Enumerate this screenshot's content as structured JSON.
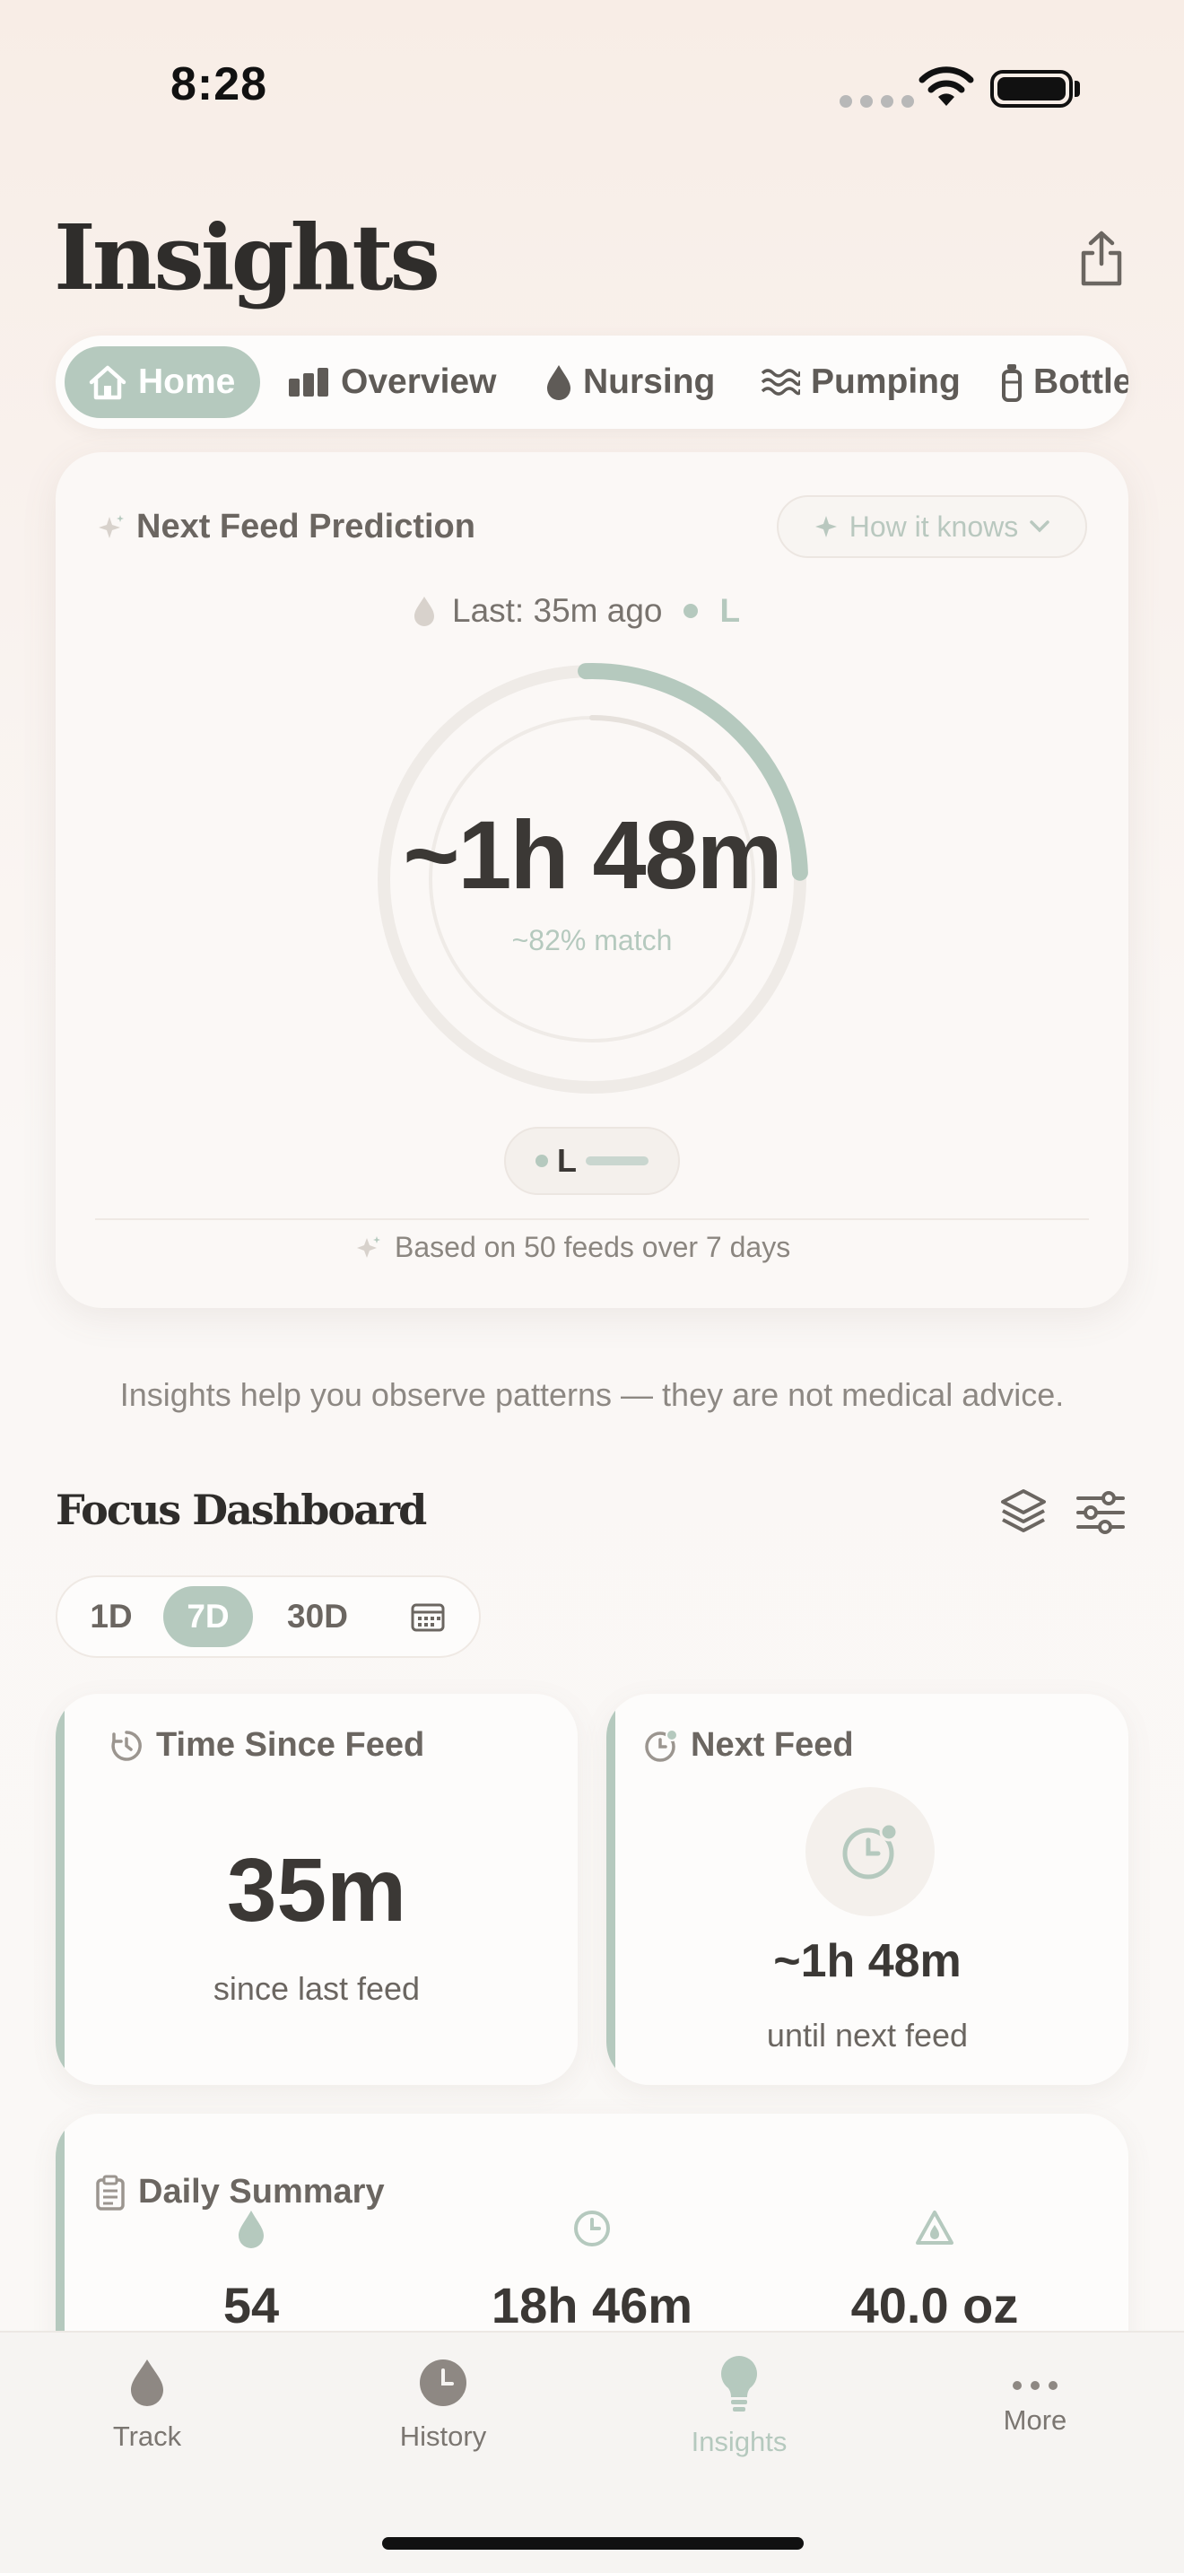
{
  "status": {
    "time": "8:28"
  },
  "header": {
    "title": "Insights"
  },
  "tabs": [
    {
      "label": "Home"
    },
    {
      "label": "Overview"
    },
    {
      "label": "Nursing"
    },
    {
      "label": "Pumping"
    },
    {
      "label": "Bottle"
    }
  ],
  "prediction": {
    "title": "Next Feed Prediction",
    "how_label": "How it knows",
    "last_label": "Last: 35m ago",
    "last_side": "L",
    "value": "~1h 48m",
    "match": "~82% match",
    "match_fraction": 0.82,
    "side_pill": "L",
    "based_on": "Based on 50 feeds over 7 days"
  },
  "disclaimer": "Insights help you observe patterns — they are not medical advice.",
  "focus": {
    "title": "Focus Dashboard",
    "ranges": [
      "1D",
      "7D",
      "30D"
    ],
    "active_range": "7D"
  },
  "time_since": {
    "label": "Time Since Feed",
    "value": "35m",
    "sub": "since last feed"
  },
  "next_feed": {
    "label": "Next Feed",
    "value": "~1h 48m",
    "sub": "until next feed"
  },
  "daily_summary": {
    "label": "Daily Summary",
    "values": [
      "54",
      "18h 46m",
      "40.0 oz"
    ]
  },
  "nav": [
    {
      "label": "Track"
    },
    {
      "label": "History"
    },
    {
      "label": "Insights"
    },
    {
      "label": "More"
    }
  ],
  "colors": {
    "accent": "#b5c9be",
    "text": "#3b3835",
    "muted": "#6b6661"
  }
}
